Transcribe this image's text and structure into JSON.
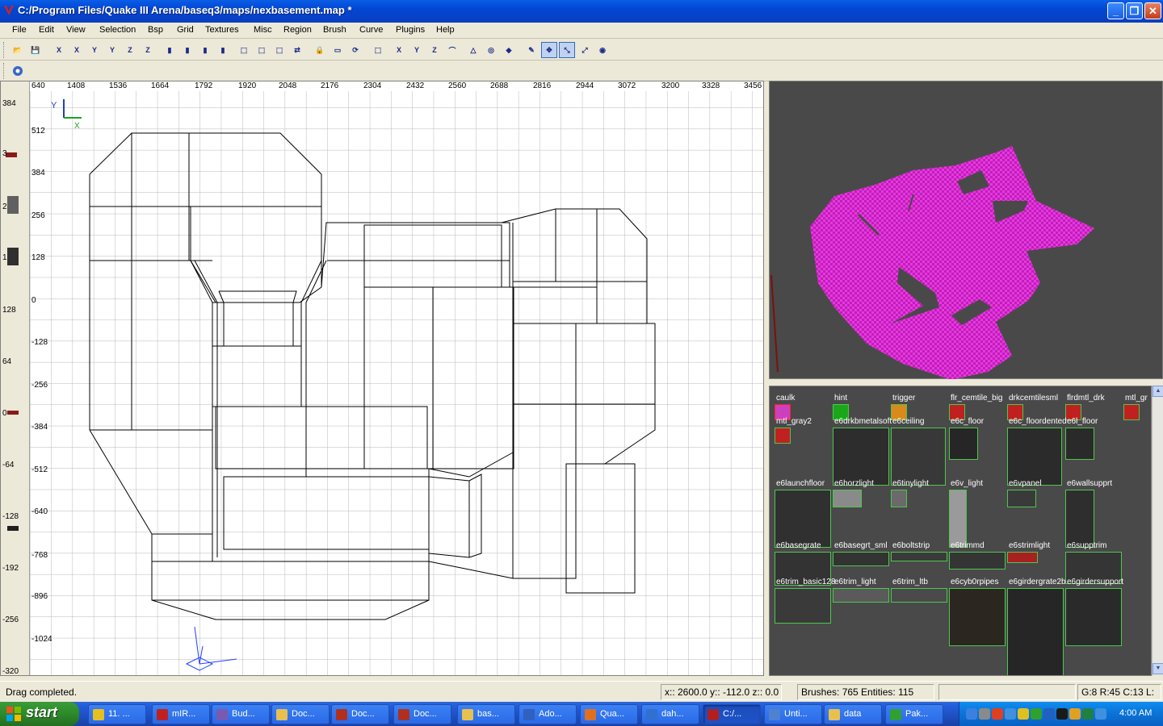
{
  "window": {
    "title": "C:/Program Files/Quake III Arena/baseq3/maps/nexbasement.map *",
    "minimize_label": "_",
    "maximize_label": "❐",
    "close_label": "✕"
  },
  "menu": [
    "File",
    "Edit",
    "View",
    "Selection",
    "Bsp",
    "Grid",
    "Textures",
    "Misc",
    "Region",
    "Brush",
    "Curve",
    "Plugins",
    "Help"
  ],
  "toolbar": {
    "buttons": [
      {
        "icon": "open-icon",
        "glyph": "📂"
      },
      {
        "icon": "save-icon",
        "glyph": "💾"
      },
      {
        "icon": "flip-x-icon",
        "glyph": "X"
      },
      {
        "icon": "rotate-x-icon",
        "glyph": "X"
      },
      {
        "icon": "flip-y-icon",
        "glyph": "Y"
      },
      {
        "icon": "rotate-y-icon",
        "glyph": "Y"
      },
      {
        "icon": "flip-z-icon",
        "glyph": "Z"
      },
      {
        "icon": "rotate-z-icon",
        "glyph": "Z"
      },
      {
        "icon": "csg-subtract-icon",
        "glyph": "▮"
      },
      {
        "icon": "csg-merge-icon",
        "glyph": "▮"
      },
      {
        "icon": "csg-hollow-icon",
        "glyph": "▮"
      },
      {
        "icon": "clip-icon",
        "glyph": "▮"
      },
      {
        "icon": "select-complete-icon",
        "glyph": "⬚"
      },
      {
        "icon": "select-touching-icon",
        "glyph": "⬚"
      },
      {
        "icon": "select-inside-icon",
        "glyph": "⬚"
      },
      {
        "icon": "change-views-icon",
        "glyph": "⇄"
      },
      {
        "icon": "texture-lock-icon",
        "glyph": "🔒"
      },
      {
        "icon": "camera-icon",
        "glyph": "▭"
      },
      {
        "icon": "refresh-icon",
        "glyph": "⟳"
      },
      {
        "icon": "view-cubic-icon",
        "glyph": "⬚"
      },
      {
        "icon": "view-x-icon",
        "glyph": "X"
      },
      {
        "icon": "view-y-icon",
        "glyph": "Y"
      },
      {
        "icon": "view-z-icon",
        "glyph": "Z"
      },
      {
        "icon": "patch-bevel-icon",
        "glyph": "⌒"
      },
      {
        "icon": "patch-cone-icon",
        "glyph": "△"
      },
      {
        "icon": "patch-cylinder-icon",
        "glyph": "◎"
      },
      {
        "icon": "patch-sphere-icon",
        "glyph": "◆"
      },
      {
        "icon": "patch-tool-icon",
        "glyph": "✎"
      },
      {
        "icon": "drag-edges-icon",
        "glyph": "✥"
      },
      {
        "icon": "drag-vertices-icon",
        "glyph": "⤡"
      },
      {
        "icon": "scale-icon",
        "glyph": "⤢"
      },
      {
        "icon": "entity-icon",
        "glyph": "◉"
      }
    ],
    "plugin_icon": "plugin-gear-icon"
  },
  "view2d": {
    "axis_vertical_label": "Y",
    "axis_horizontal_label": "X",
    "top_ruler": [
      "640",
      "1408",
      "1536",
      "1664",
      "1792",
      "1920",
      "2048",
      "2176",
      "2304",
      "2432",
      "2560",
      "2688",
      "2816",
      "2944",
      "3072",
      "3200",
      "3328",
      "3456"
    ],
    "left_labels": [
      "512",
      "384",
      "256",
      "128",
      "0",
      "-128",
      "-256",
      "-384",
      "-512",
      "-640",
      "-768",
      "-896",
      "-1024"
    ],
    "z_ruler": [
      "384",
      "3",
      "2",
      "1",
      "128",
      "64",
      "0",
      "-64",
      "-128",
      "-192",
      "-256",
      "-320"
    ]
  },
  "textures": [
    {
      "name": "caulk",
      "color": "#cc3fbf"
    },
    {
      "name": "hint",
      "color": "#1aa81a"
    },
    {
      "name": "trigger",
      "color": "#d98a1a"
    },
    {
      "name": "flr_cemtile_big",
      "color": "#c02020"
    },
    {
      "name": "drkcemtilesml",
      "color": "#c02020"
    },
    {
      "name": "flrdmtl_drk",
      "color": "#c02020"
    },
    {
      "name": "mtl_gr",
      "color": "#c02020"
    },
    {
      "name": "mtl_gray2",
      "color": "#c02020"
    },
    {
      "name": "e6drkbmetalsoft",
      "color": "#2d2d2d"
    },
    {
      "name": "e6ceiling",
      "color": "#383838"
    },
    {
      "name": "e6c_floor",
      "color": "#262626"
    },
    {
      "name": "e6c_floordented",
      "color": "#2b2b2b"
    },
    {
      "name": "e6l_floor",
      "color": "#2a2a2a"
    },
    {
      "name": "e6launchfloor",
      "color": "#303030"
    },
    {
      "name": "e6horzlight",
      "color": "#8a8a8a"
    },
    {
      "name": "e6tinylight",
      "color": "#6a6a6a"
    },
    {
      "name": "e6v_light",
      "color": "#9a9a9a"
    },
    {
      "name": "e6vpanel",
      "color": "#3a3a3a"
    },
    {
      "name": "e6wallsupprt",
      "color": "#2e2e2e"
    },
    {
      "name": "e6basegrate",
      "color": "#333333"
    },
    {
      "name": "e6basegrt_sml",
      "color": "#333333"
    },
    {
      "name": "e6boltstrip",
      "color": "#3a3a3a"
    },
    {
      "name": "e6trimmd",
      "color": "#353535"
    },
    {
      "name": "e6strimlight",
      "color": "#a82020"
    },
    {
      "name": "e6supptrim",
      "color": "#353535"
    },
    {
      "name": "e6trim_basic128",
      "color": "#3a3a3a"
    },
    {
      "name": "e6trim_light",
      "color": "#5a5a5a"
    },
    {
      "name": "e6trim_ltb",
      "color": "#4a4a4a"
    },
    {
      "name": "e6cyb0rpipes",
      "color": "#2c2620"
    },
    {
      "name": "e6girdergrate2b",
      "color": "#262626"
    },
    {
      "name": "e6girdersupport",
      "color": "#2a2a2a"
    }
  ],
  "status": {
    "message": "Drag completed.",
    "coords": "x:: 2600.0  y:: -112.0  z:: 0.0",
    "counts": "Brushes: 765 Entities: 115",
    "empty": "",
    "grid": "G:8 R:45 C:13 L:"
  },
  "taskbar": {
    "start_label": "start",
    "tasks": [
      {
        "label": "11. ...",
        "color": "#e6c020"
      },
      {
        "label": "mIR...",
        "color": "#c02020"
      },
      {
        "label": "Bud...",
        "color": "#7a5ab0"
      },
      {
        "label": "Doc...",
        "color": "#e8c050"
      },
      {
        "label": "Doc...",
        "color": "#b03020"
      },
      {
        "label": "Doc...",
        "color": "#b03020"
      },
      {
        "label": "bas...",
        "color": "#e8c050"
      },
      {
        "label": "Ado...",
        "color": "#3060c0"
      },
      {
        "label": "Qua...",
        "color": "#e07020"
      },
      {
        "label": "dah...",
        "color": "#3070d0"
      },
      {
        "label": "C:/...",
        "color": "#b02020"
      },
      {
        "label": "Unti...",
        "color": "#5080d0"
      },
      {
        "label": "data",
        "color": "#e8c050"
      },
      {
        "label": "Pak...",
        "color": "#30a030"
      }
    ],
    "tray_icons": [
      "#3a80e0",
      "#8a8a8a",
      "#e04020",
      "#4090e0",
      "#e0c020",
      "#30a030",
      "#2060c0",
      "#1a1a1a",
      "#e0a020",
      "#208040",
      "#4090e0"
    ],
    "clock": "4:00 AM"
  }
}
